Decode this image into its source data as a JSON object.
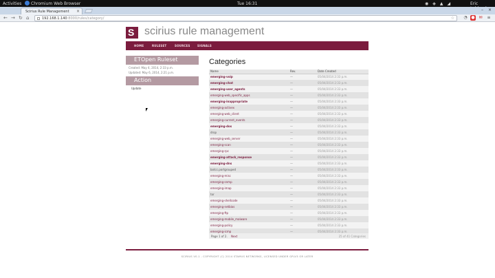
{
  "system": {
    "activities": "Activities",
    "app_name": "Chromium Web Browser",
    "clock": "Tue 16:31",
    "user": "Eric Leblond"
  },
  "browser": {
    "tab_title": "Scirius Rule Management",
    "url_host": "192.168.1.140",
    "url_path": ":8000/rules/category/"
  },
  "brand": {
    "logo_glyph": "S",
    "title": "scirius rule management",
    "color": "#7b1c3e"
  },
  "nav": [
    "HOME",
    "RULESET",
    "SOURCES",
    "SIGNALS"
  ],
  "sidebar": {
    "source_title": "ETOpen Ruleset",
    "created": "Created: May 4, 2014, 2:33 p.m.",
    "updated": "Updated: May 6, 2014, 2:21 p.m.",
    "action_title": "Action",
    "update_link": "Update"
  },
  "categories": {
    "title": "Categories",
    "headers": [
      "Name",
      "Rev.",
      "Date Created"
    ],
    "rows": [
      {
        "name": "emerging-voip",
        "rev": "—",
        "created": "05/04/2014 2:33 p.m."
      },
      {
        "name": "emerging-chat",
        "rev": "—",
        "created": "05/04/2014 2:33 p.m."
      },
      {
        "name": "emerging-user_agents",
        "rev": "—",
        "created": "05/04/2014 2:33 p.m."
      },
      {
        "name": "emerging-web_specific_apps",
        "rev": "—",
        "created": "05/04/2014 2:33 p.m."
      },
      {
        "name": "emerging-inappropriate",
        "rev": "—",
        "created": "05/04/2014 2:33 p.m."
      },
      {
        "name": "emerging-activex",
        "rev": "—",
        "created": "05/04/2014 2:33 p.m."
      },
      {
        "name": "emerging-web_client",
        "rev": "—",
        "created": "05/04/2014 2:33 p.m."
      },
      {
        "name": "emerging-current_events",
        "rev": "—",
        "created": "05/04/2014 2:33 p.m."
      },
      {
        "name": "emerging-dos",
        "rev": "—",
        "created": "05/04/2014 2:33 p.m."
      },
      {
        "name": "drop",
        "rev": "—",
        "created": "05/04/2014 2:33 p.m."
      },
      {
        "name": "emerging-web_server",
        "rev": "—",
        "created": "05/04/2014 2:33 p.m."
      },
      {
        "name": "emerging-scan",
        "rev": "—",
        "created": "05/04/2014 2:33 p.m."
      },
      {
        "name": "emerging-rpc",
        "rev": "—",
        "created": "05/04/2014 2:33 p.m."
      },
      {
        "name": "emerging-attack_response",
        "rev": "—",
        "created": "05/04/2014 2:33 p.m."
      },
      {
        "name": "emerging-dns",
        "rev": "—",
        "created": "05/04/2014 2:33 p.m."
      },
      {
        "name": "botcc.portgrouped",
        "rev": "—",
        "created": "05/04/2014 2:33 p.m."
      },
      {
        "name": "emerging-misc",
        "rev": "—",
        "created": "05/04/2014 2:33 p.m."
      },
      {
        "name": "emerging-snmp",
        "rev": "—",
        "created": "05/04/2014 2:33 p.m."
      },
      {
        "name": "emerging-imap",
        "rev": "—",
        "created": "05/04/2014 2:33 p.m."
      },
      {
        "name": "tor",
        "rev": "—",
        "created": "05/04/2014 2:33 p.m."
      },
      {
        "name": "emerging-shellcode",
        "rev": "—",
        "created": "05/04/2014 2:33 p.m."
      },
      {
        "name": "emerging-netbios",
        "rev": "—",
        "created": "05/04/2014 2:33 p.m."
      },
      {
        "name": "emerging-ftp",
        "rev": "—",
        "created": "05/04/2014 2:33 p.m."
      },
      {
        "name": "emerging-mobile_malware",
        "rev": "—",
        "created": "05/04/2014 2:33 p.m."
      },
      {
        "name": "emerging-policy",
        "rev": "—",
        "created": "05/04/2014 2:33 p.m."
      },
      {
        "name": "emerging-icmp",
        "rev": "—",
        "created": "05/04/2014 2:33 p.m."
      }
    ],
    "pager_text": "Page 1 of 2.",
    "pager_next": "Next",
    "total": "25 of 41 Categories"
  },
  "footer": "SCIRIUS V0.1 - COPYRIGHT (C) 2014 STAMUS NETWORKS, LICENSED UNDER GPLV3 OR LATER"
}
